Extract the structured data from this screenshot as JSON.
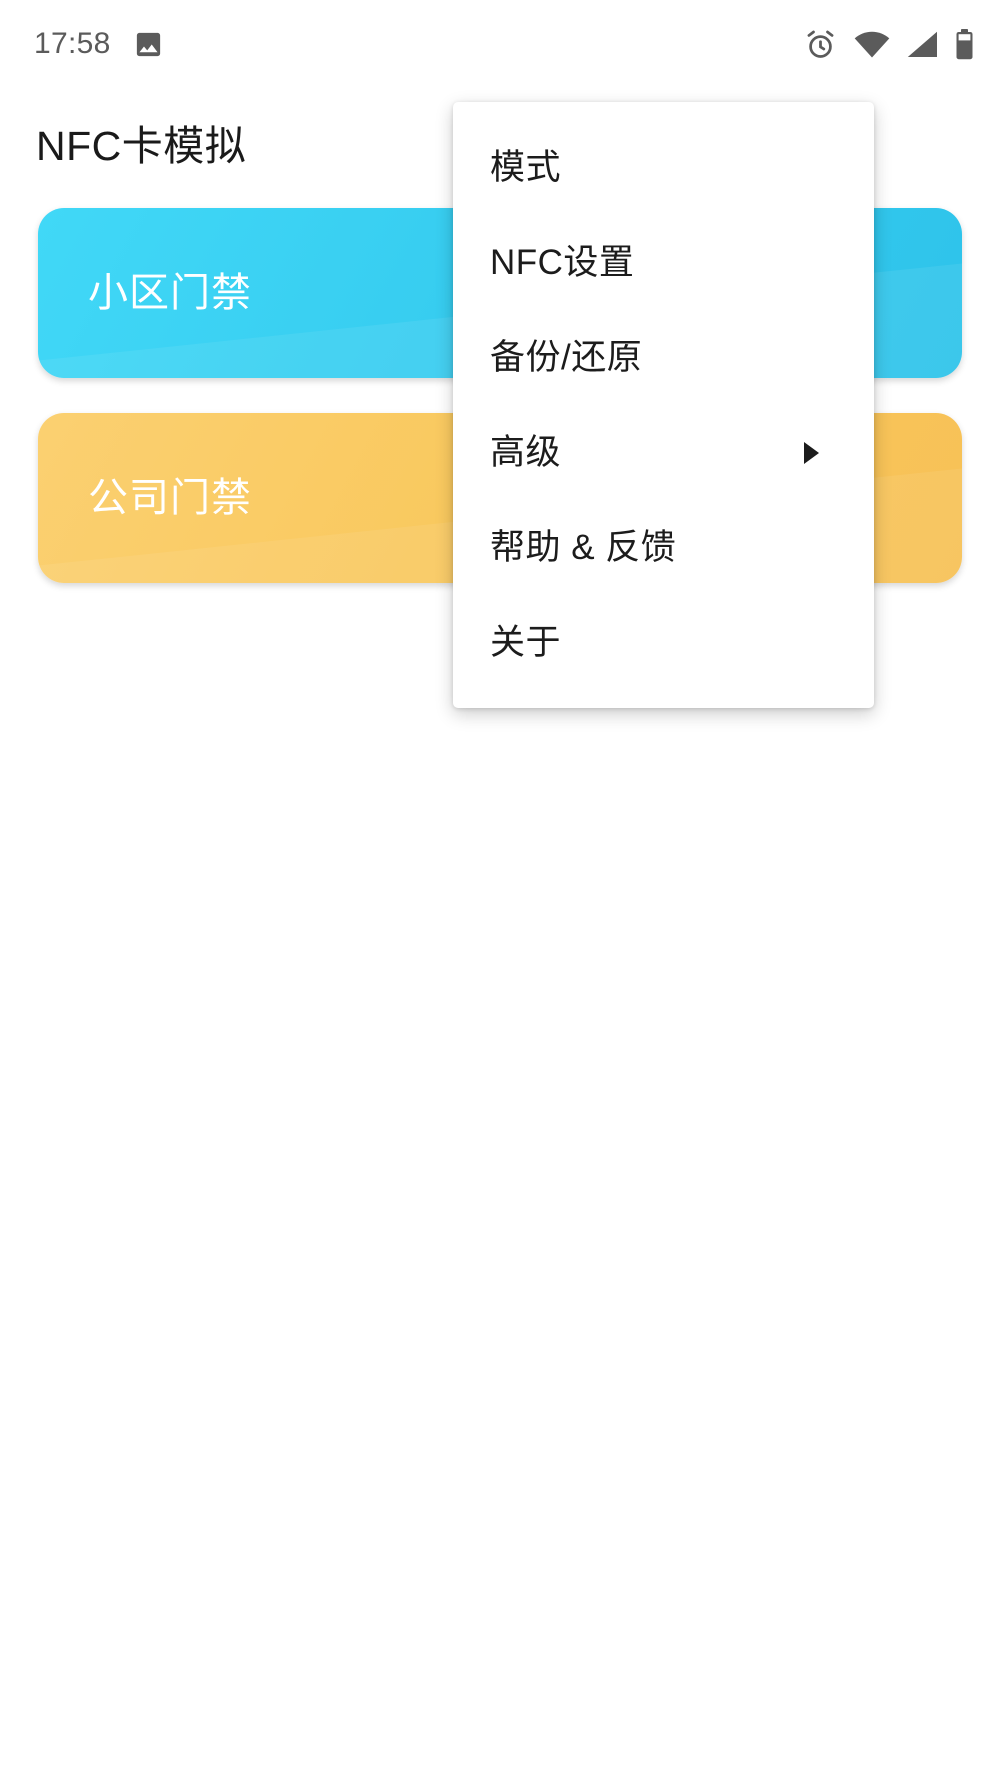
{
  "status_bar": {
    "clock": "17:58",
    "left_icons": [
      {
        "name": "image-icon",
        "glyph": "image"
      }
    ],
    "right_icons": [
      {
        "name": "alarm-clock-icon",
        "glyph": "alarm"
      },
      {
        "name": "wifi-icon",
        "glyph": "wifi"
      },
      {
        "name": "cellular-signal-icon",
        "glyph": "signal"
      },
      {
        "name": "battery-icon",
        "glyph": "battery"
      }
    ]
  },
  "app": {
    "title": "NFC卡模拟"
  },
  "cards": [
    {
      "label": "小区门禁",
      "color": "#35d1f0"
    },
    {
      "label": "公司门禁",
      "color": "#f9c95f"
    }
  ],
  "menu": {
    "items": [
      {
        "label": "模式",
        "has_submenu": false
      },
      {
        "label": "NFC设置",
        "has_submenu": false
      },
      {
        "label": "备份/还原",
        "has_submenu": false
      },
      {
        "label": "高级",
        "has_submenu": true
      },
      {
        "label": "帮助 & 反馈",
        "has_submenu": false
      },
      {
        "label": "关于",
        "has_submenu": false
      }
    ]
  },
  "colors": {
    "status_icon": "#5b5b5b",
    "text_primary": "#1a1a1a",
    "card_blue": "#35d1f0",
    "card_yellow": "#f9c95f",
    "menu_background": "#ffffff"
  }
}
